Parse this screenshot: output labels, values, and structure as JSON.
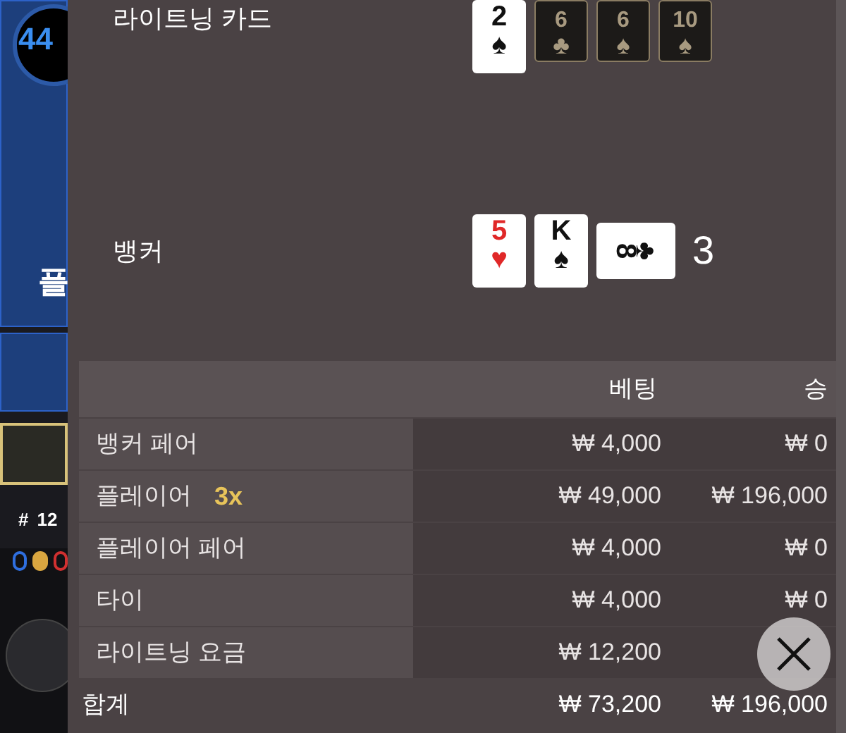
{
  "background": {
    "timer": "44",
    "side_label": "플",
    "round_mark": "#",
    "round_number": "12",
    "beads": [
      {
        "color": "#2f6fe0",
        "filled": false
      },
      {
        "color": "#d9a640",
        "filled": true
      },
      {
        "color": "#d03030",
        "filled": false
      }
    ]
  },
  "hands": [
    {
      "label": "라이트닝 카드",
      "cards": [
        {
          "kind": "face",
          "rank": "2",
          "suit": "♠",
          "color": "#111111"
        },
        {
          "kind": "lightning",
          "rank": "6",
          "suit": "♣",
          "color": "#a89a80"
        },
        {
          "kind": "lightning",
          "rank": "6",
          "suit": "♠",
          "color": "#a89a80"
        },
        {
          "kind": "lightning",
          "rank": "10",
          "suit": "♠",
          "color": "#a89a80"
        }
      ]
    },
    {
      "label": "뱅커",
      "score": "3",
      "cards": [
        {
          "kind": "face",
          "rank": "5",
          "suit": "♥",
          "color": "#e02828"
        },
        {
          "kind": "face",
          "rank": "K",
          "suit": "♠",
          "color": "#111111"
        },
        {
          "kind": "sideways",
          "rank": "8",
          "suit": "♣",
          "color": "#111111"
        }
      ]
    }
  ],
  "table": {
    "columns": [
      "베팅",
      "승"
    ],
    "rows": [
      {
        "label": "뱅커 페어",
        "bet": "₩ 4,000",
        "win": "₩ 0"
      },
      {
        "label": "플레이어",
        "multiplier": "3x",
        "bet": "₩ 49,000",
        "win": "₩ 196,000"
      },
      {
        "label": "플레이어 페어",
        "bet": "₩ 4,000",
        "win": "₩ 0"
      },
      {
        "label": "타이",
        "bet": "₩ 4,000",
        "win": "₩ 0"
      },
      {
        "label": "라이트닝 요금",
        "bet": "₩ 12,200"
      }
    ],
    "total": {
      "label": "합계",
      "bet": "₩ 73,200",
      "win": "₩ 196,000"
    }
  }
}
